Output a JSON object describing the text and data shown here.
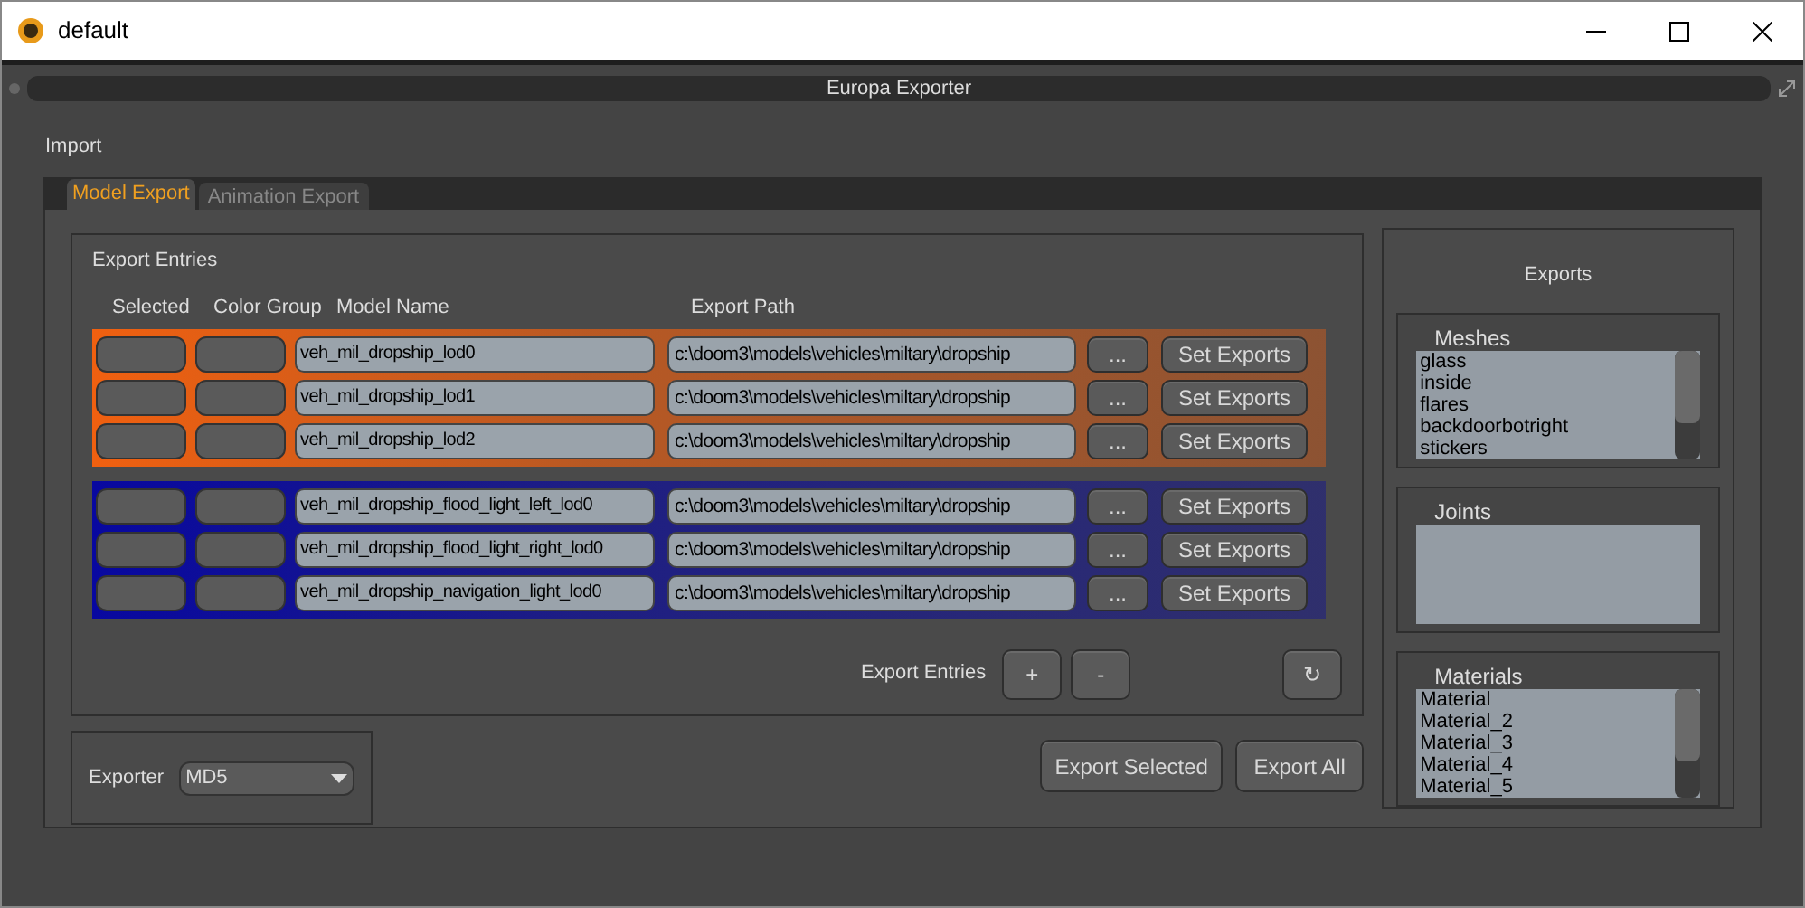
{
  "window": {
    "title": "default"
  },
  "panel": {
    "title": "Europa Exporter"
  },
  "menu": [
    "Import"
  ],
  "tabs": [
    {
      "label": "Model Export",
      "selected": true
    },
    {
      "label": "Animation Export",
      "selected": false
    }
  ],
  "entries": {
    "title": "Export Entries",
    "columns": [
      "Selected",
      "Color Group",
      "Model Name",
      "Export Path"
    ],
    "groups": [
      {
        "color": "#f06010",
        "rows": [
          {
            "model_name": "veh_mil_dropship_lod0",
            "export_path": "c:\\doom3\\models\\vehicles\\miltary\\dropship",
            "browse": "...",
            "set_exports": "Set Exports"
          },
          {
            "model_name": "veh_mil_dropship_lod1",
            "export_path": "c:\\doom3\\models\\vehicles\\miltary\\dropship",
            "browse": "...",
            "set_exports": "Set Exports"
          },
          {
            "model_name": "veh_mil_dropship_lod2",
            "export_path": "c:\\doom3\\models\\vehicles\\miltary\\dropship",
            "browse": "...",
            "set_exports": "Set Exports"
          }
        ]
      },
      {
        "color": "#0808a0",
        "rows": [
          {
            "model_name": "veh_mil_dropship_flood_light_left_lod0",
            "export_path": "c:\\doom3\\models\\vehicles\\miltary\\dropship",
            "browse": "...",
            "set_exports": "Set Exports"
          },
          {
            "model_name": "veh_mil_dropship_flood_light_right_lod0",
            "export_path": "c:\\doom3\\models\\vehicles\\miltary\\dropship",
            "browse": "...",
            "set_exports": "Set Exports"
          },
          {
            "model_name": "veh_mil_dropship_navigation_light_lod0",
            "export_path": "c:\\doom3\\models\\vehicles\\miltary\\dropship",
            "browse": "...",
            "set_exports": "Set Exports"
          }
        ]
      }
    ],
    "footer_label": "Export Entries",
    "add": "+",
    "remove": "-",
    "refresh": "↻"
  },
  "exporter": {
    "label": "Exporter",
    "value": "MD5"
  },
  "actions": [
    "Export Selected",
    "Export All"
  ],
  "exports": {
    "title": "Exports",
    "lists": [
      {
        "title": "Meshes",
        "items": [
          "glass",
          "inside",
          "flares",
          "backdoorbotright",
          "stickers"
        ],
        "scrollbar": true
      },
      {
        "title": "Joints",
        "scrollbar": false
      },
      {
        "title": "Materials",
        "items": [
          "Material",
          "Material_2",
          "Material_3",
          "Material_4",
          "Material_5"
        ],
        "scrollbar": true
      }
    ]
  }
}
